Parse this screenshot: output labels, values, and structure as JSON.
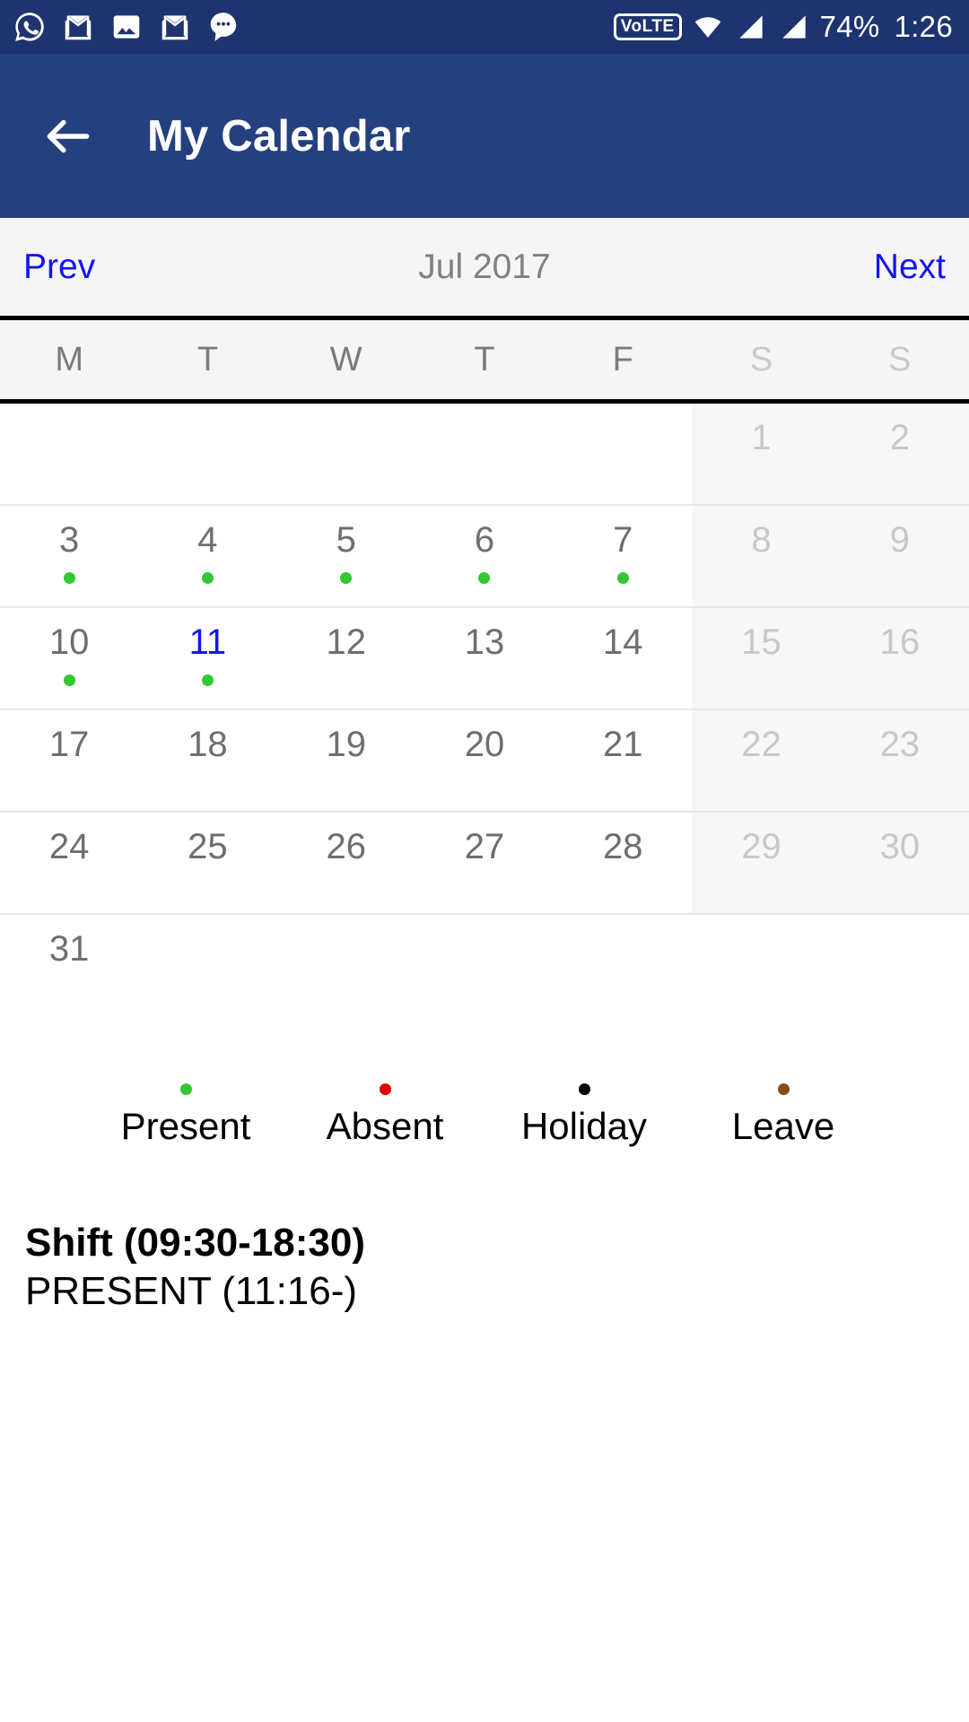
{
  "status_bar": {
    "notification_icons": [
      "whatsapp-icon",
      "gmail-icon",
      "gallery-icon",
      "gmail-icon",
      "messages-icon"
    ],
    "volte_label": "VoLTE",
    "wifi_icon": "wifi-icon",
    "signal_icons": [
      "signal-bars-sim1-icon",
      "signal-bars-sim2-icon"
    ],
    "battery_percent": "74%",
    "time": "1:26"
  },
  "app_bar": {
    "back_icon": "back-arrow-icon",
    "title": "My Calendar"
  },
  "month_nav": {
    "prev_label": "Prev",
    "title": "Jul 2017",
    "next_label": "Next",
    "link_color": "#1414f0"
  },
  "weekdays": [
    {
      "label": "M",
      "weekend": false
    },
    {
      "label": "T",
      "weekend": false
    },
    {
      "label": "W",
      "weekend": false
    },
    {
      "label": "T",
      "weekend": false
    },
    {
      "label": "F",
      "weekend": false
    },
    {
      "label": "S",
      "weekend": true
    },
    {
      "label": "S",
      "weekend": true
    }
  ],
  "calendar": {
    "weeks": [
      [
        {
          "day": "",
          "state": "empty"
        },
        {
          "day": "",
          "state": "empty"
        },
        {
          "day": "",
          "state": "empty"
        },
        {
          "day": "",
          "state": "empty"
        },
        {
          "day": "",
          "state": "empty"
        },
        {
          "day": "1",
          "state": "weekend",
          "marker": "none"
        },
        {
          "day": "2",
          "state": "weekend",
          "marker": "none"
        }
      ],
      [
        {
          "day": "3",
          "state": "normal",
          "marker": "present"
        },
        {
          "day": "4",
          "state": "normal",
          "marker": "present"
        },
        {
          "day": "5",
          "state": "normal",
          "marker": "present"
        },
        {
          "day": "6",
          "state": "normal",
          "marker": "present"
        },
        {
          "day": "7",
          "state": "normal",
          "marker": "present"
        },
        {
          "day": "8",
          "state": "weekend",
          "marker": "none"
        },
        {
          "day": "9",
          "state": "weekend",
          "marker": "none"
        }
      ],
      [
        {
          "day": "10",
          "state": "normal",
          "marker": "present"
        },
        {
          "day": "11",
          "state": "selected",
          "marker": "present"
        },
        {
          "day": "12",
          "state": "normal",
          "marker": "none"
        },
        {
          "day": "13",
          "state": "normal",
          "marker": "none"
        },
        {
          "day": "14",
          "state": "normal",
          "marker": "none"
        },
        {
          "day": "15",
          "state": "weekend",
          "marker": "none"
        },
        {
          "day": "16",
          "state": "weekend",
          "marker": "none"
        }
      ],
      [
        {
          "day": "17",
          "state": "normal",
          "marker": "none"
        },
        {
          "day": "18",
          "state": "normal",
          "marker": "none"
        },
        {
          "day": "19",
          "state": "normal",
          "marker": "none"
        },
        {
          "day": "20",
          "state": "normal",
          "marker": "none"
        },
        {
          "day": "21",
          "state": "normal",
          "marker": "none"
        },
        {
          "day": "22",
          "state": "weekend",
          "marker": "none"
        },
        {
          "day": "23",
          "state": "weekend",
          "marker": "none"
        }
      ],
      [
        {
          "day": "24",
          "state": "normal",
          "marker": "none"
        },
        {
          "day": "25",
          "state": "normal",
          "marker": "none"
        },
        {
          "day": "26",
          "state": "normal",
          "marker": "none"
        },
        {
          "day": "27",
          "state": "normal",
          "marker": "none"
        },
        {
          "day": "28",
          "state": "normal",
          "marker": "none"
        },
        {
          "day": "29",
          "state": "weekend",
          "marker": "none"
        },
        {
          "day": "30",
          "state": "weekend",
          "marker": "none"
        }
      ],
      [
        {
          "day": "31",
          "state": "normal",
          "marker": "none"
        },
        {
          "day": "",
          "state": "empty"
        },
        {
          "day": "",
          "state": "empty"
        },
        {
          "day": "",
          "state": "empty"
        },
        {
          "day": "",
          "state": "empty"
        },
        {
          "day": "",
          "state": "empty"
        },
        {
          "day": "",
          "state": "empty"
        }
      ]
    ]
  },
  "legend": [
    {
      "label": "Present",
      "color": "#32c832"
    },
    {
      "label": "Absent",
      "color": "#e00000"
    },
    {
      "label": "Holiday",
      "color": "#000000"
    },
    {
      "label": "Leave",
      "color": "#8a4b14"
    }
  ],
  "shift_info": {
    "shift": "Shift (09:30-18:30)",
    "attendance": "PRESENT (11:16-)"
  }
}
